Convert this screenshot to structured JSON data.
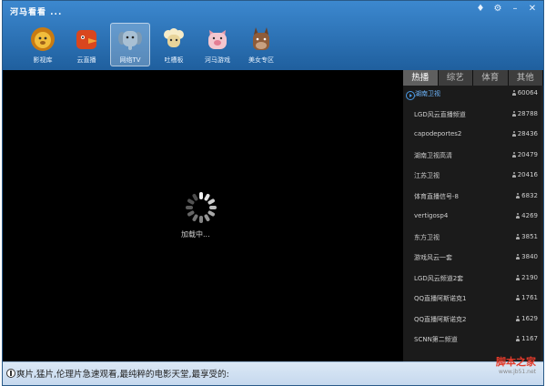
{
  "app_title": "河马看看 ...",
  "window_controls": [
    {
      "name": "skin",
      "glyph": "♦"
    },
    {
      "name": "settings",
      "glyph": "⚙"
    },
    {
      "name": "minimize",
      "glyph": "–"
    },
    {
      "name": "close",
      "glyph": "✕"
    }
  ],
  "nav": [
    {
      "label": "影视库",
      "icon": "lion-icon",
      "color": "#e8a524"
    },
    {
      "label": "云直播",
      "icon": "bird-icon",
      "color": "#d9461e"
    },
    {
      "label": "网络TV",
      "icon": "elephant-icon",
      "color": "#9bb4c8",
      "active": true
    },
    {
      "label": "吐槽板",
      "icon": "sheep-icon",
      "color": "#efe0b0"
    },
    {
      "label": "河马游戏",
      "icon": "pig-icon",
      "color": "#f0b8c4"
    },
    {
      "label": "美女专区",
      "icon": "donkey-icon",
      "color": "#8a5a3a"
    }
  ],
  "player": {
    "loading_text": "加载中..."
  },
  "tabs": [
    {
      "label": "热播",
      "active": true
    },
    {
      "label": "综艺"
    },
    {
      "label": "体育"
    },
    {
      "label": "其他"
    }
  ],
  "channels": [
    {
      "name": "湖南卫视",
      "count": "60064",
      "active": true
    },
    {
      "name": "LGD风云直播频道",
      "count": "28788"
    },
    {
      "name": "capodeportes2",
      "count": "28436"
    },
    {
      "name": "湖南卫视高清",
      "count": "20479"
    },
    {
      "name": "江苏卫视",
      "count": "20416"
    },
    {
      "name": "体育直播信号-8",
      "count": "6832"
    },
    {
      "name": "vertigosp4",
      "count": "4269"
    },
    {
      "name": "东方卫视",
      "count": "3851"
    },
    {
      "name": "游戏风云一套",
      "count": "3840"
    },
    {
      "name": "LGD风云频道2套",
      "count": "2190"
    },
    {
      "name": "QQ直播阿斯诺克1",
      "count": "1761"
    },
    {
      "name": "QQ直播阿斯诺克2",
      "count": "1629"
    },
    {
      "name": "SCNN第二频道",
      "count": "1167"
    }
  ],
  "footer": {
    "ticker": "爽片,猛片,伦理片急速观看,最纯粹的电影天堂,最享受的:"
  },
  "watermark": {
    "main": "脚本之家",
    "sub": "www.jb51.net"
  }
}
